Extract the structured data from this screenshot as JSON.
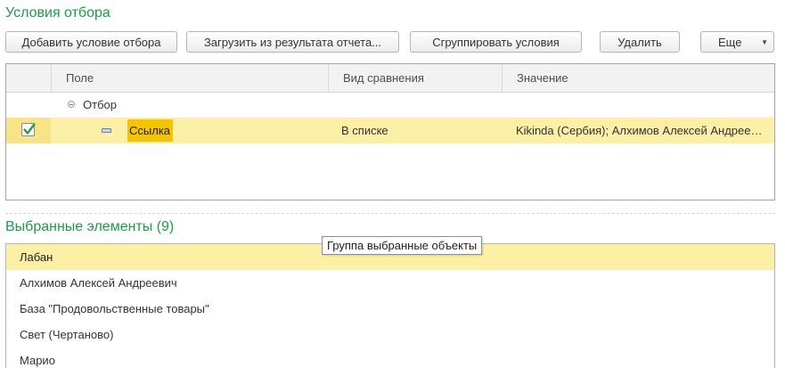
{
  "filter_section": {
    "title": "Условия отбора",
    "toolbar": {
      "add_label": "Добавить условие отбора",
      "load_label": "Загрузить из результата отчета...",
      "group_label": "Сгруппировать условия",
      "delete_label": "Удалить",
      "more_label": "Еще"
    },
    "table": {
      "columns": [
        "",
        "Поле",
        "Вид сравнения",
        "Значение"
      ],
      "group_row": {
        "label": "Отбор"
      },
      "rows": [
        {
          "checked": true,
          "field": "Ссылка",
          "comparison": "В списке",
          "value": "Kikinda (Сербия); Алхимов Алексей Андреевич; База \"Продовольственные товары\"; Свет (Чертаново); Марио"
        }
      ]
    }
  },
  "selected_section": {
    "title": "Выбранные элементы (9)",
    "tooltip": "Группа выбранные объекты",
    "items": [
      {
        "label": "Лабан",
        "selected": true
      },
      {
        "label": "Алхимов Алексей Андреевич",
        "selected": false
      },
      {
        "label": "База \"Продовольственные товары\"",
        "selected": false
      },
      {
        "label": "Свет (Чертаново)",
        "selected": false
      },
      {
        "label": "Марио",
        "selected": false
      }
    ]
  },
  "colors": {
    "title_green": "#1d9a4a",
    "selection_yellow": "#fbf0a6",
    "field_highlight": "#f5c400",
    "check_green": "#2a9d3c"
  },
  "icons": {
    "checkbox": "checkbox-checked-icon",
    "group": "collapse-circle-icon",
    "field": "field-item-icon",
    "more": "chevron-down-icon"
  }
}
